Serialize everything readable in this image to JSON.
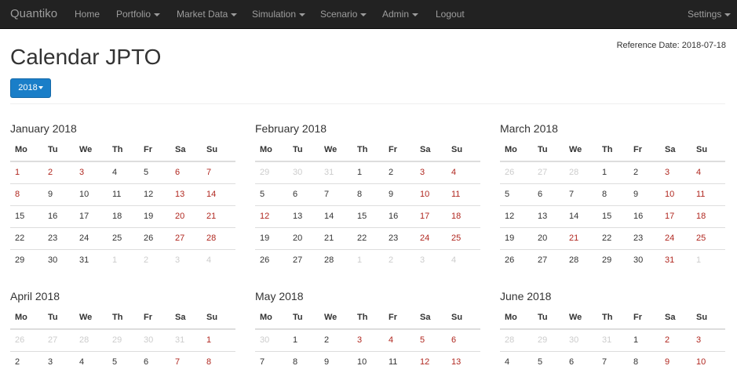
{
  "navbar": {
    "brand": "Quantiko",
    "items": [
      {
        "label": "Home",
        "dropdown": false
      },
      {
        "label": "Portfolio",
        "dropdown": true
      },
      {
        "label": "Market Data",
        "dropdown": true
      },
      {
        "label": "Simulation",
        "dropdown": true
      },
      {
        "label": "Scenario",
        "dropdown": true
      },
      {
        "label": "Admin",
        "dropdown": true
      },
      {
        "label": "Logout",
        "dropdown": false
      }
    ],
    "settings": {
      "label": "Settings",
      "dropdown": true
    }
  },
  "reference_date": "Reference Date: 2018-07-18",
  "page_title": "Calendar JPTO",
  "year_select": {
    "label": "2018"
  },
  "weekdays": [
    "Mo",
    "Tu",
    "We",
    "Th",
    "Fr",
    "Sa",
    "Su"
  ],
  "colors": {
    "holiday": "#b0271f",
    "other_month": "#cccccc",
    "primary_button": "#1a7ec8",
    "navbar": "#222222"
  },
  "months": [
    {
      "title": "January 2018",
      "weeks": [
        [
          {
            "d": "1",
            "t": "h"
          },
          {
            "d": "2",
            "t": "h"
          },
          {
            "d": "3",
            "t": "h"
          },
          {
            "d": "4",
            "t": "n"
          },
          {
            "d": "5",
            "t": "n"
          },
          {
            "d": "6",
            "t": "h"
          },
          {
            "d": "7",
            "t": "h"
          }
        ],
        [
          {
            "d": "8",
            "t": "h"
          },
          {
            "d": "9",
            "t": "n"
          },
          {
            "d": "10",
            "t": "n"
          },
          {
            "d": "11",
            "t": "n"
          },
          {
            "d": "12",
            "t": "n"
          },
          {
            "d": "13",
            "t": "h"
          },
          {
            "d": "14",
            "t": "h"
          }
        ],
        [
          {
            "d": "15",
            "t": "n"
          },
          {
            "d": "16",
            "t": "n"
          },
          {
            "d": "17",
            "t": "n"
          },
          {
            "d": "18",
            "t": "n"
          },
          {
            "d": "19",
            "t": "n"
          },
          {
            "d": "20",
            "t": "h"
          },
          {
            "d": "21",
            "t": "h"
          }
        ],
        [
          {
            "d": "22",
            "t": "n"
          },
          {
            "d": "23",
            "t": "n"
          },
          {
            "d": "24",
            "t": "n"
          },
          {
            "d": "25",
            "t": "n"
          },
          {
            "d": "26",
            "t": "n"
          },
          {
            "d": "27",
            "t": "h"
          },
          {
            "d": "28",
            "t": "h"
          }
        ],
        [
          {
            "d": "29",
            "t": "n"
          },
          {
            "d": "30",
            "t": "n"
          },
          {
            "d": "31",
            "t": "n"
          },
          {
            "d": "1",
            "t": "o"
          },
          {
            "d": "2",
            "t": "o"
          },
          {
            "d": "3",
            "t": "o"
          },
          {
            "d": "4",
            "t": "o"
          }
        ]
      ]
    },
    {
      "title": "February 2018",
      "weeks": [
        [
          {
            "d": "29",
            "t": "o"
          },
          {
            "d": "30",
            "t": "o"
          },
          {
            "d": "31",
            "t": "o"
          },
          {
            "d": "1",
            "t": "n"
          },
          {
            "d": "2",
            "t": "n"
          },
          {
            "d": "3",
            "t": "h"
          },
          {
            "d": "4",
            "t": "h"
          }
        ],
        [
          {
            "d": "5",
            "t": "n"
          },
          {
            "d": "6",
            "t": "n"
          },
          {
            "d": "7",
            "t": "n"
          },
          {
            "d": "8",
            "t": "n"
          },
          {
            "d": "9",
            "t": "n"
          },
          {
            "d": "10",
            "t": "h"
          },
          {
            "d": "11",
            "t": "h"
          }
        ],
        [
          {
            "d": "12",
            "t": "h"
          },
          {
            "d": "13",
            "t": "n"
          },
          {
            "d": "14",
            "t": "n"
          },
          {
            "d": "15",
            "t": "n"
          },
          {
            "d": "16",
            "t": "n"
          },
          {
            "d": "17",
            "t": "h"
          },
          {
            "d": "18",
            "t": "h"
          }
        ],
        [
          {
            "d": "19",
            "t": "n"
          },
          {
            "d": "20",
            "t": "n"
          },
          {
            "d": "21",
            "t": "n"
          },
          {
            "d": "22",
            "t": "n"
          },
          {
            "d": "23",
            "t": "n"
          },
          {
            "d": "24",
            "t": "h"
          },
          {
            "d": "25",
            "t": "h"
          }
        ],
        [
          {
            "d": "26",
            "t": "n"
          },
          {
            "d": "27",
            "t": "n"
          },
          {
            "d": "28",
            "t": "n"
          },
          {
            "d": "1",
            "t": "o"
          },
          {
            "d": "2",
            "t": "o"
          },
          {
            "d": "3",
            "t": "o"
          },
          {
            "d": "4",
            "t": "o"
          }
        ]
      ]
    },
    {
      "title": "March 2018",
      "weeks": [
        [
          {
            "d": "26",
            "t": "o"
          },
          {
            "d": "27",
            "t": "o"
          },
          {
            "d": "28",
            "t": "o"
          },
          {
            "d": "1",
            "t": "n"
          },
          {
            "d": "2",
            "t": "n"
          },
          {
            "d": "3",
            "t": "h"
          },
          {
            "d": "4",
            "t": "h"
          }
        ],
        [
          {
            "d": "5",
            "t": "n"
          },
          {
            "d": "6",
            "t": "n"
          },
          {
            "d": "7",
            "t": "n"
          },
          {
            "d": "8",
            "t": "n"
          },
          {
            "d": "9",
            "t": "n"
          },
          {
            "d": "10",
            "t": "h"
          },
          {
            "d": "11",
            "t": "h"
          }
        ],
        [
          {
            "d": "12",
            "t": "n"
          },
          {
            "d": "13",
            "t": "n"
          },
          {
            "d": "14",
            "t": "n"
          },
          {
            "d": "15",
            "t": "n"
          },
          {
            "d": "16",
            "t": "n"
          },
          {
            "d": "17",
            "t": "h"
          },
          {
            "d": "18",
            "t": "h"
          }
        ],
        [
          {
            "d": "19",
            "t": "n"
          },
          {
            "d": "20",
            "t": "n"
          },
          {
            "d": "21",
            "t": "h"
          },
          {
            "d": "22",
            "t": "n"
          },
          {
            "d": "23",
            "t": "n"
          },
          {
            "d": "24",
            "t": "h"
          },
          {
            "d": "25",
            "t": "h"
          }
        ],
        [
          {
            "d": "26",
            "t": "n"
          },
          {
            "d": "27",
            "t": "n"
          },
          {
            "d": "28",
            "t": "n"
          },
          {
            "d": "29",
            "t": "n"
          },
          {
            "d": "30",
            "t": "n"
          },
          {
            "d": "31",
            "t": "h"
          },
          {
            "d": "1",
            "t": "o"
          }
        ]
      ]
    },
    {
      "title": "April 2018",
      "weeks": [
        [
          {
            "d": "26",
            "t": "o"
          },
          {
            "d": "27",
            "t": "o"
          },
          {
            "d": "28",
            "t": "o"
          },
          {
            "d": "29",
            "t": "o"
          },
          {
            "d": "30",
            "t": "o"
          },
          {
            "d": "31",
            "t": "o"
          },
          {
            "d": "1",
            "t": "h"
          }
        ],
        [
          {
            "d": "2",
            "t": "n"
          },
          {
            "d": "3",
            "t": "n"
          },
          {
            "d": "4",
            "t": "n"
          },
          {
            "d": "5",
            "t": "n"
          },
          {
            "d": "6",
            "t": "n"
          },
          {
            "d": "7",
            "t": "h"
          },
          {
            "d": "8",
            "t": "h"
          }
        ]
      ]
    },
    {
      "title": "May 2018",
      "weeks": [
        [
          {
            "d": "30",
            "t": "o"
          },
          {
            "d": "1",
            "t": "n"
          },
          {
            "d": "2",
            "t": "n"
          },
          {
            "d": "3",
            "t": "h"
          },
          {
            "d": "4",
            "t": "h"
          },
          {
            "d": "5",
            "t": "h"
          },
          {
            "d": "6",
            "t": "h"
          }
        ],
        [
          {
            "d": "7",
            "t": "n"
          },
          {
            "d": "8",
            "t": "n"
          },
          {
            "d": "9",
            "t": "n"
          },
          {
            "d": "10",
            "t": "n"
          },
          {
            "d": "11",
            "t": "n"
          },
          {
            "d": "12",
            "t": "h"
          },
          {
            "d": "13",
            "t": "h"
          }
        ]
      ]
    },
    {
      "title": "June 2018",
      "weeks": [
        [
          {
            "d": "28",
            "t": "o"
          },
          {
            "d": "29",
            "t": "o"
          },
          {
            "d": "30",
            "t": "o"
          },
          {
            "d": "31",
            "t": "o"
          },
          {
            "d": "1",
            "t": "n"
          },
          {
            "d": "2",
            "t": "h"
          },
          {
            "d": "3",
            "t": "h"
          }
        ],
        [
          {
            "d": "4",
            "t": "n"
          },
          {
            "d": "5",
            "t": "n"
          },
          {
            "d": "6",
            "t": "n"
          },
          {
            "d": "7",
            "t": "n"
          },
          {
            "d": "8",
            "t": "n"
          },
          {
            "d": "9",
            "t": "h"
          },
          {
            "d": "10",
            "t": "h"
          }
        ]
      ]
    }
  ]
}
